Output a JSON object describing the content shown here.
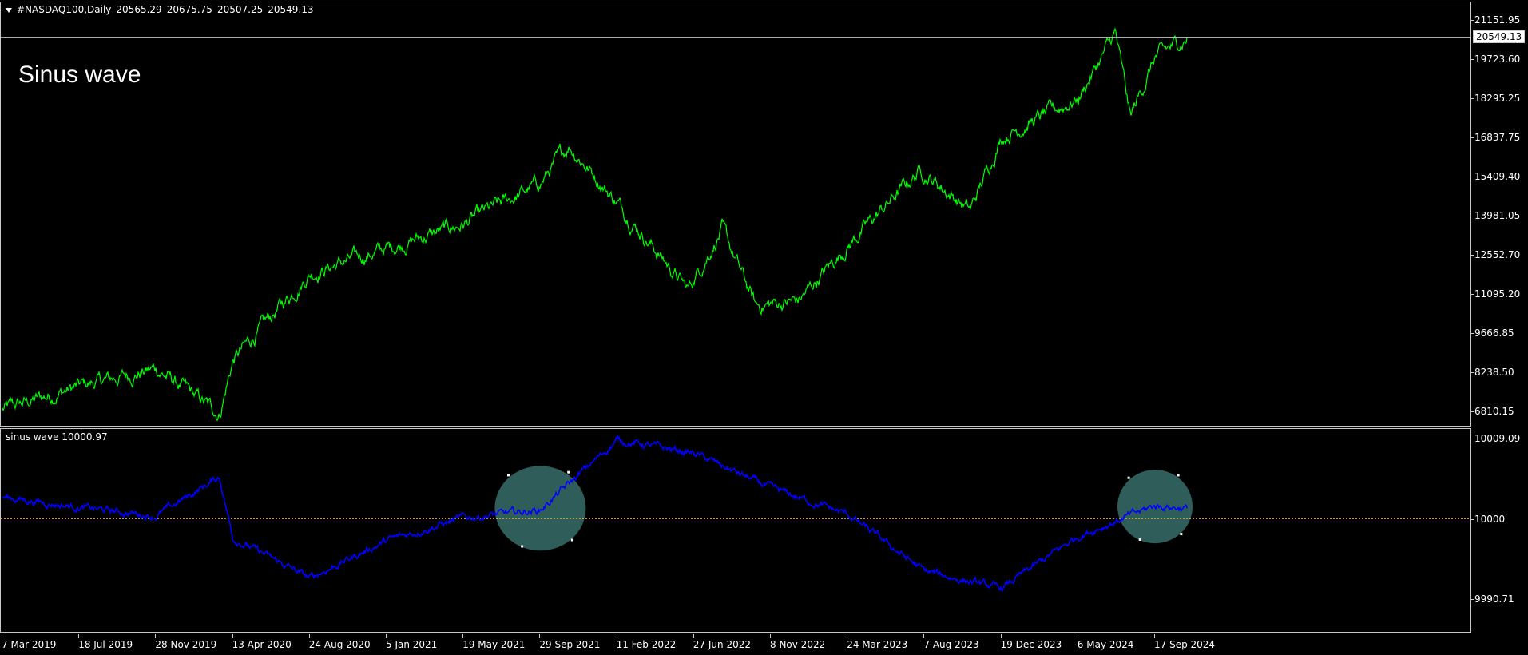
{
  "main": {
    "symbol": "#NASDAQ100,Daily",
    "open": "20565.29",
    "high": "20675.75",
    "low": "20507.25",
    "close": "20549.13",
    "annotation": "Sinus wave",
    "current_price_label": "20549.13",
    "price_ticks": [
      "21151.95",
      "19723.60",
      "18295.25",
      "16837.75",
      "15409.40",
      "13981.05",
      "12552.70",
      "11095.20",
      "9666.85",
      "8238.50",
      "6810.15"
    ]
  },
  "indicator": {
    "title": "sinus wave 10000.97",
    "ticks": [
      "10009.09",
      "10000",
      "9990.71"
    ],
    "zero_level": 10000
  },
  "time_axis": [
    "7 Mar 2019",
    "18 Jul 2019",
    "28 Nov 2019",
    "13 Apr 2020",
    "24 Aug 2020",
    "5 Jan 2021",
    "19 May 2021",
    "29 Sep 2021",
    "11 Feb 2022",
    "27 Jun 2022",
    "8 Nov 2022",
    "24 Mar 2023",
    "7 Aug 2023",
    "19 Dec 2023",
    "6 May 2024",
    "17 Sep 2024"
  ],
  "colors": {
    "price_line": "#00ff00",
    "indicator_line": "#0000ff",
    "level_line": "#ffa500",
    "highlight": "#2f5d5a",
    "background": "#000000"
  },
  "chart_data": {
    "type": "line",
    "series": [
      {
        "name": "#NASDAQ100,Daily",
        "x": [
          "7 Mar 2019",
          "18 Jul 2019",
          "28 Nov 2019",
          "20 Mar 2020",
          "13 Apr 2020",
          "24 Aug 2020",
          "5 Jan 2021",
          "19 May 2021",
          "29 Sep 2021",
          "19 Nov 2021",
          "11 Feb 2022",
          "16 Jun 2022",
          "15 Aug 2022",
          "13 Oct 2022",
          "28 Dec 2022",
          "24 Mar 2023",
          "31 Jul 2023",
          "26 Oct 2023",
          "19 Dec 2023",
          "6 May 2024",
          "10 Jul 2024",
          "5 Aug 2024",
          "17 Sep 2024",
          "13 Nov 2024"
        ],
        "values": [
          6900,
          7750,
          8400,
          6750,
          8700,
          11900,
          12800,
          13700,
          15200,
          16600,
          14500,
          11300,
          13500,
          10700,
          10900,
          12900,
          15700,
          14200,
          16900,
          18300,
          20700,
          17600,
          19800,
          20549
        ]
      },
      {
        "name": "sinus wave",
        "x": [
          "7 Mar 2019",
          "18 Jul 2019",
          "28 Nov 2019",
          "20 Mar 2020",
          "13 Apr 2020",
          "24 Aug 2020",
          "5 Jan 2021",
          "19 May 2021",
          "29 Sep 2021",
          "11 Feb 2022",
          "27 Jun 2022",
          "8 Nov 2022",
          "24 Mar 2023",
          "7 Aug 2023",
          "19 Dec 2023",
          "6 May 2024",
          "17 Sep 2024",
          "13 Nov 2024"
        ],
        "values": [
          10002.5,
          10001.3,
          10000.3,
          10004.8,
          9997.8,
          9993.2,
          9997.5,
          10000.1,
          10001.0,
          10009.0,
          10007.5,
          10003.5,
          10000.5,
          9994.0,
          9992.0,
          9998.0,
          10001.5,
          10001.2
        ]
      }
    ],
    "ylim_main": [
      6810.15,
      21151.95
    ],
    "ylim_indicator": [
      9990.71,
      10009.09
    ]
  }
}
